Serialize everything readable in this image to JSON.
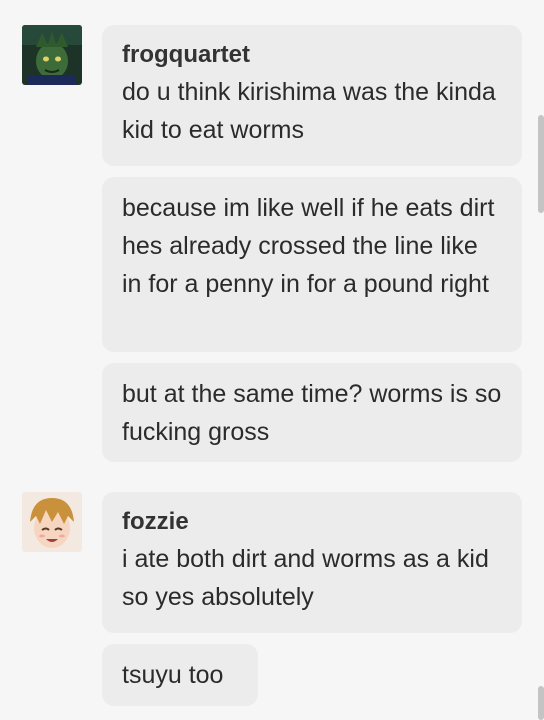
{
  "messages": [
    {
      "sender": "frogquartet",
      "avatar_icon": "frog-character-avatar",
      "bubbles": [
        "do u think kirishima was the kinda kid to eat worms",
        "because im like well if he eats dirt hes already crossed the line like in for a penny in for a pound right",
        "but at the same time? worms is so fucking gross"
      ]
    },
    {
      "sender": "fozzie",
      "avatar_icon": "anime-boy-avatar",
      "bubbles": [
        "i ate both dirt and worms as a kid so yes absolutely",
        "tsuyu too"
      ]
    }
  ],
  "colors": {
    "background": "#f6f6f6",
    "bubble": "#ececec",
    "text": "#2b2b2b",
    "scrollbar": "#c4c4c4"
  }
}
